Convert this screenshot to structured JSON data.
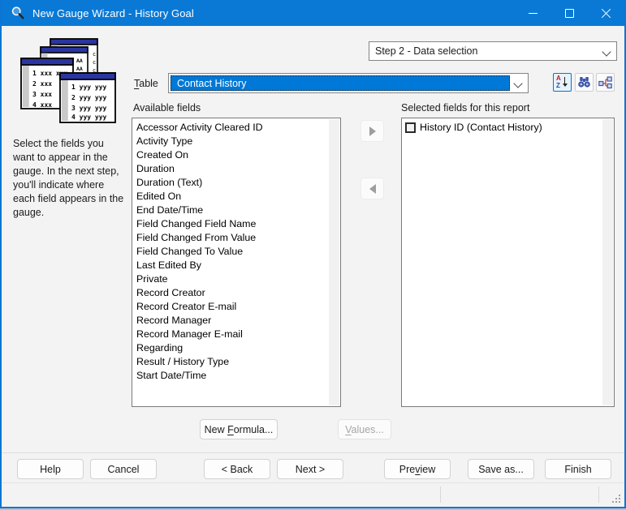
{
  "title_bar": {
    "title": "New Gauge Wizard - History Goal"
  },
  "step_selector": {
    "value": "Step 2 - Data selection"
  },
  "sidebar": {
    "instruction": "Select the fields you want to appear in the gauge. In the next step, you'll indicate where each field appears in the gauge."
  },
  "table_row": {
    "label_key": "T",
    "label_rest": "able",
    "value": "Contact History"
  },
  "toolbar": {
    "sort_a": "A",
    "sort_z": "Z"
  },
  "icons": {
    "app": "magnifier-icon",
    "sort": "sort-az-icon",
    "find": "binoculars-icon",
    "relationship": "table-relationship-icon",
    "graphic": "stacked-report-windows"
  },
  "graphic": {
    "front_rows": [
      "1 yyy yyy",
      "2 yyy yyy",
      "3 yyy yyy",
      "4 yyy yyy"
    ],
    "mid_rows": [
      "1 xxx xxx",
      "2 xxx",
      "3 xxx",
      "4 xxx"
    ],
    "fragment_aa": "AA",
    "fragment_c": "c"
  },
  "available": {
    "label": "Available fields",
    "items": [
      "Accessor Activity Cleared ID",
      "Activity Type",
      "Created On",
      "Duration",
      "Duration (Text)",
      "Edited On",
      "End Date/Time",
      "Field Changed Field Name",
      "Field Changed From Value",
      "Field Changed To Value",
      "Last Edited By",
      "Private",
      "Record Creator",
      "Record Creator E-mail",
      "Record Manager",
      "Record Manager E-mail",
      "Regarding",
      "Result / History Type",
      "Start Date/Time"
    ]
  },
  "selected": {
    "label": "Selected fields for this report",
    "items": [
      "History ID (Contact History)"
    ]
  },
  "mid_buttons": {
    "new_formula_pre": "New ",
    "new_formula_key": "F",
    "new_formula_rest": "ormula...",
    "values_key": "V",
    "values_rest": "alues..."
  },
  "footer_buttons": {
    "help": "Help",
    "cancel": "Cancel",
    "back": "< Back",
    "next": "Next >",
    "preview_pre": "Pre",
    "preview_key": "v",
    "preview_rest": "iew",
    "save_as": "Save as...",
    "finish": "Finish"
  },
  "colors": {
    "titlebar": "#0a79d6",
    "accent_border": "#0b76d4",
    "selection": "#0078d7",
    "dialog_bg": "#f3f3f3"
  }
}
